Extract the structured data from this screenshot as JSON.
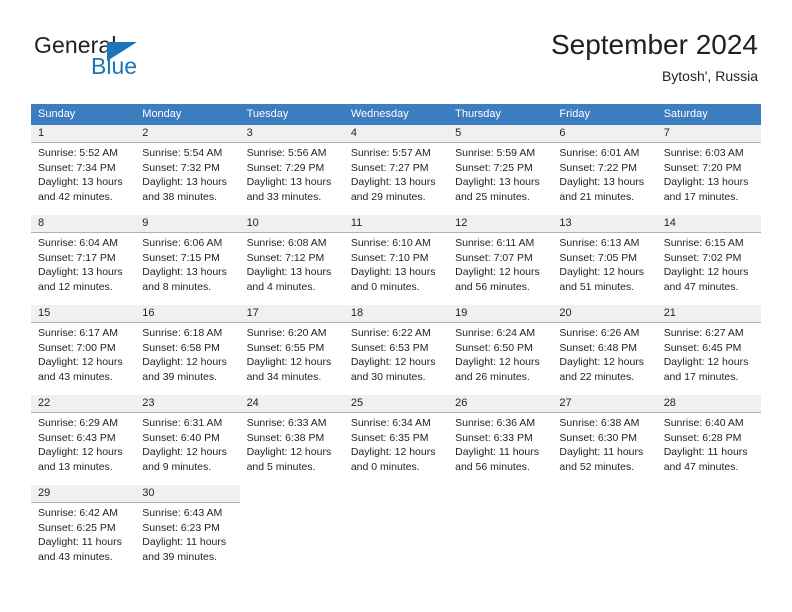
{
  "brand": {
    "name_part1": "General",
    "name_part2": "Blue",
    "triangle_color": "#1b75bb",
    "text_color": "#231f20"
  },
  "header": {
    "title": "September 2024",
    "subtitle": "Bytosh', Russia"
  },
  "calendar": {
    "header_bg": "#3c7dbf",
    "header_text_color": "#ffffff",
    "date_band_bg": "#f0f0f0",
    "weekdays": [
      "Sunday",
      "Monday",
      "Tuesday",
      "Wednesday",
      "Thursday",
      "Friday",
      "Saturday"
    ],
    "weeks": [
      [
        {
          "date": "1",
          "sunrise": "Sunrise: 5:52 AM",
          "sunset": "Sunset: 7:34 PM",
          "daylight1": "Daylight: 13 hours",
          "daylight2": "and 42 minutes."
        },
        {
          "date": "2",
          "sunrise": "Sunrise: 5:54 AM",
          "sunset": "Sunset: 7:32 PM",
          "daylight1": "Daylight: 13 hours",
          "daylight2": "and 38 minutes."
        },
        {
          "date": "3",
          "sunrise": "Sunrise: 5:56 AM",
          "sunset": "Sunset: 7:29 PM",
          "daylight1": "Daylight: 13 hours",
          "daylight2": "and 33 minutes."
        },
        {
          "date": "4",
          "sunrise": "Sunrise: 5:57 AM",
          "sunset": "Sunset: 7:27 PM",
          "daylight1": "Daylight: 13 hours",
          "daylight2": "and 29 minutes."
        },
        {
          "date": "5",
          "sunrise": "Sunrise: 5:59 AM",
          "sunset": "Sunset: 7:25 PM",
          "daylight1": "Daylight: 13 hours",
          "daylight2": "and 25 minutes."
        },
        {
          "date": "6",
          "sunrise": "Sunrise: 6:01 AM",
          "sunset": "Sunset: 7:22 PM",
          "daylight1": "Daylight: 13 hours",
          "daylight2": "and 21 minutes."
        },
        {
          "date": "7",
          "sunrise": "Sunrise: 6:03 AM",
          "sunset": "Sunset: 7:20 PM",
          "daylight1": "Daylight: 13 hours",
          "daylight2": "and 17 minutes."
        }
      ],
      [
        {
          "date": "8",
          "sunrise": "Sunrise: 6:04 AM",
          "sunset": "Sunset: 7:17 PM",
          "daylight1": "Daylight: 13 hours",
          "daylight2": "and 12 minutes."
        },
        {
          "date": "9",
          "sunrise": "Sunrise: 6:06 AM",
          "sunset": "Sunset: 7:15 PM",
          "daylight1": "Daylight: 13 hours",
          "daylight2": "and 8 minutes."
        },
        {
          "date": "10",
          "sunrise": "Sunrise: 6:08 AM",
          "sunset": "Sunset: 7:12 PM",
          "daylight1": "Daylight: 13 hours",
          "daylight2": "and 4 minutes."
        },
        {
          "date": "11",
          "sunrise": "Sunrise: 6:10 AM",
          "sunset": "Sunset: 7:10 PM",
          "daylight1": "Daylight: 13 hours",
          "daylight2": "and 0 minutes."
        },
        {
          "date": "12",
          "sunrise": "Sunrise: 6:11 AM",
          "sunset": "Sunset: 7:07 PM",
          "daylight1": "Daylight: 12 hours",
          "daylight2": "and 56 minutes."
        },
        {
          "date": "13",
          "sunrise": "Sunrise: 6:13 AM",
          "sunset": "Sunset: 7:05 PM",
          "daylight1": "Daylight: 12 hours",
          "daylight2": "and 51 minutes."
        },
        {
          "date": "14",
          "sunrise": "Sunrise: 6:15 AM",
          "sunset": "Sunset: 7:02 PM",
          "daylight1": "Daylight: 12 hours",
          "daylight2": "and 47 minutes."
        }
      ],
      [
        {
          "date": "15",
          "sunrise": "Sunrise: 6:17 AM",
          "sunset": "Sunset: 7:00 PM",
          "daylight1": "Daylight: 12 hours",
          "daylight2": "and 43 minutes."
        },
        {
          "date": "16",
          "sunrise": "Sunrise: 6:18 AM",
          "sunset": "Sunset: 6:58 PM",
          "daylight1": "Daylight: 12 hours",
          "daylight2": "and 39 minutes."
        },
        {
          "date": "17",
          "sunrise": "Sunrise: 6:20 AM",
          "sunset": "Sunset: 6:55 PM",
          "daylight1": "Daylight: 12 hours",
          "daylight2": "and 34 minutes."
        },
        {
          "date": "18",
          "sunrise": "Sunrise: 6:22 AM",
          "sunset": "Sunset: 6:53 PM",
          "daylight1": "Daylight: 12 hours",
          "daylight2": "and 30 minutes."
        },
        {
          "date": "19",
          "sunrise": "Sunrise: 6:24 AM",
          "sunset": "Sunset: 6:50 PM",
          "daylight1": "Daylight: 12 hours",
          "daylight2": "and 26 minutes."
        },
        {
          "date": "20",
          "sunrise": "Sunrise: 6:26 AM",
          "sunset": "Sunset: 6:48 PM",
          "daylight1": "Daylight: 12 hours",
          "daylight2": "and 22 minutes."
        },
        {
          "date": "21",
          "sunrise": "Sunrise: 6:27 AM",
          "sunset": "Sunset: 6:45 PM",
          "daylight1": "Daylight: 12 hours",
          "daylight2": "and 17 minutes."
        }
      ],
      [
        {
          "date": "22",
          "sunrise": "Sunrise: 6:29 AM",
          "sunset": "Sunset: 6:43 PM",
          "daylight1": "Daylight: 12 hours",
          "daylight2": "and 13 minutes."
        },
        {
          "date": "23",
          "sunrise": "Sunrise: 6:31 AM",
          "sunset": "Sunset: 6:40 PM",
          "daylight1": "Daylight: 12 hours",
          "daylight2": "and 9 minutes."
        },
        {
          "date": "24",
          "sunrise": "Sunrise: 6:33 AM",
          "sunset": "Sunset: 6:38 PM",
          "daylight1": "Daylight: 12 hours",
          "daylight2": "and 5 minutes."
        },
        {
          "date": "25",
          "sunrise": "Sunrise: 6:34 AM",
          "sunset": "Sunset: 6:35 PM",
          "daylight1": "Daylight: 12 hours",
          "daylight2": "and 0 minutes."
        },
        {
          "date": "26",
          "sunrise": "Sunrise: 6:36 AM",
          "sunset": "Sunset: 6:33 PM",
          "daylight1": "Daylight: 11 hours",
          "daylight2": "and 56 minutes."
        },
        {
          "date": "27",
          "sunrise": "Sunrise: 6:38 AM",
          "sunset": "Sunset: 6:30 PM",
          "daylight1": "Daylight: 11 hours",
          "daylight2": "and 52 minutes."
        },
        {
          "date": "28",
          "sunrise": "Sunrise: 6:40 AM",
          "sunset": "Sunset: 6:28 PM",
          "daylight1": "Daylight: 11 hours",
          "daylight2": "and 47 minutes."
        }
      ],
      [
        {
          "date": "29",
          "sunrise": "Sunrise: 6:42 AM",
          "sunset": "Sunset: 6:25 PM",
          "daylight1": "Daylight: 11 hours",
          "daylight2": "and 43 minutes."
        },
        {
          "date": "30",
          "sunrise": "Sunrise: 6:43 AM",
          "sunset": "Sunset: 6:23 PM",
          "daylight1": "Daylight: 11 hours",
          "daylight2": "and 39 minutes."
        },
        null,
        null,
        null,
        null,
        null
      ]
    ]
  }
}
